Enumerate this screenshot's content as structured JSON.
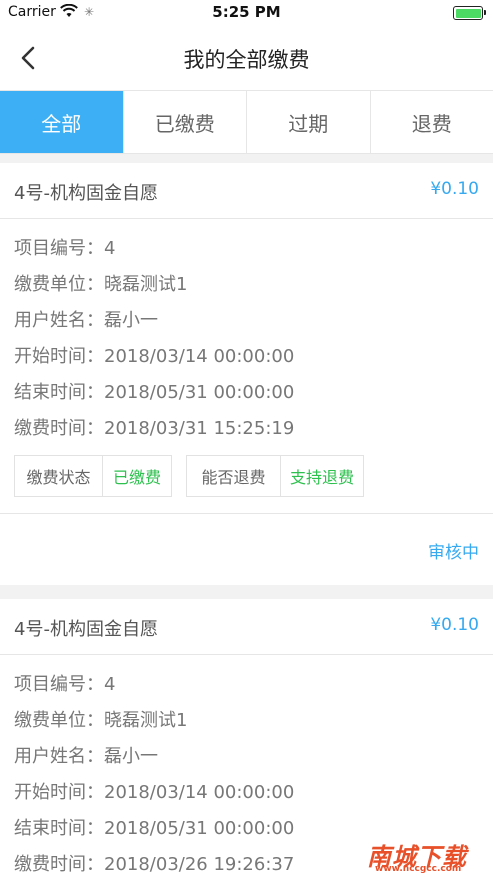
{
  "status_bar": {
    "carrier": "Carrier",
    "time": "5:25 PM"
  },
  "nav": {
    "title": "我的全部缴费"
  },
  "tabs": [
    {
      "label": "全部",
      "active": true
    },
    {
      "label": "已缴费",
      "active": false
    },
    {
      "label": "过期",
      "active": false
    },
    {
      "label": "退费",
      "active": false
    }
  ],
  "records": [
    {
      "name": "4号-机构固金自愿",
      "price": "¥0.10",
      "fields": [
        {
          "label": "项目编号：",
          "value": "4"
        },
        {
          "label": "缴费单位：",
          "value": "晓磊测试1"
        },
        {
          "label": "用户姓名：",
          "value": "磊小一"
        },
        {
          "label": "开始时间：",
          "value": "2018/03/14 00:00:00"
        },
        {
          "label": "结束时间：",
          "value": "2018/05/31 00:00:00"
        },
        {
          "label": "缴费时间：",
          "value": "2018/03/31 15:25:19"
        }
      ],
      "status_label": "缴费状态",
      "status_value": "已缴费",
      "refund_label": "能否退费",
      "refund_value": "支持退费",
      "audit": "审核中"
    },
    {
      "name": "4号-机构固金自愿",
      "price": "¥0.10",
      "fields": [
        {
          "label": "项目编号：",
          "value": "4"
        },
        {
          "label": "缴费单位：",
          "value": "晓磊测试1"
        },
        {
          "label": "用户姓名：",
          "value": "磊小一"
        },
        {
          "label": "开始时间：",
          "value": "2018/03/14 00:00:00"
        },
        {
          "label": "结束时间：",
          "value": "2018/05/31 00:00:00"
        },
        {
          "label": "缴费时间：",
          "value": "2018/03/26 19:26:37"
        }
      ]
    }
  ],
  "watermark": {
    "text": "南城下载",
    "url": "www.nccgcc.com"
  },
  "colors": {
    "accent": "#3daff5",
    "price": "#36a9ef",
    "paid": "#2ec04f",
    "battery": "#4cd964"
  }
}
